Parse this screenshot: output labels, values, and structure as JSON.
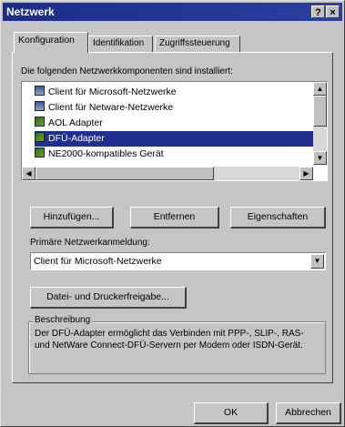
{
  "window": {
    "title": "Netzwerk",
    "help_btn": "?",
    "close_btn": "×"
  },
  "tabs": [
    {
      "label": "Konfiguration"
    },
    {
      "label": "Identifikation"
    },
    {
      "label": "Zugriffssteuerung"
    }
  ],
  "components": {
    "caption": "Die folgenden Netzwerkkomponenten sind installiert:",
    "items": [
      {
        "label": "Client für Microsoft-Netzwerke",
        "icon": "client-icon"
      },
      {
        "label": "Client für Netware-Netzwerke",
        "icon": "client-icon"
      },
      {
        "label": "AOL Adapter",
        "icon": "network-adapter-icon"
      },
      {
        "label": "DFÜ-Adapter",
        "icon": "network-adapter-icon",
        "selected": true
      },
      {
        "label": "NE2000-kompatibles Gerät",
        "icon": "network-adapter-icon"
      }
    ]
  },
  "buttons": {
    "add": "Hinzufügen...",
    "remove": "Entfernen",
    "properties": "Eigenschaften",
    "file_printer": "Datei- und Druckerfreigabe...",
    "ok": "OK",
    "cancel": "Abbrechen"
  },
  "primary_logon": {
    "label": "Primäre Netzwerkanmeldung:",
    "value": "Client für Microsoft-Netzwerke"
  },
  "description": {
    "legend": "Beschreibung",
    "text": "Der DFÜ-Adapter ermöglicht das Verbinden mit PPP-, SLIP-, RAS- und NetWare Connect-DFÜ-Servern per Modem oder ISDN-Gerät."
  },
  "colors": {
    "titlebar": "#1c2c8a",
    "selection": "#1f2e8f",
    "face": "#c5c5c8"
  }
}
